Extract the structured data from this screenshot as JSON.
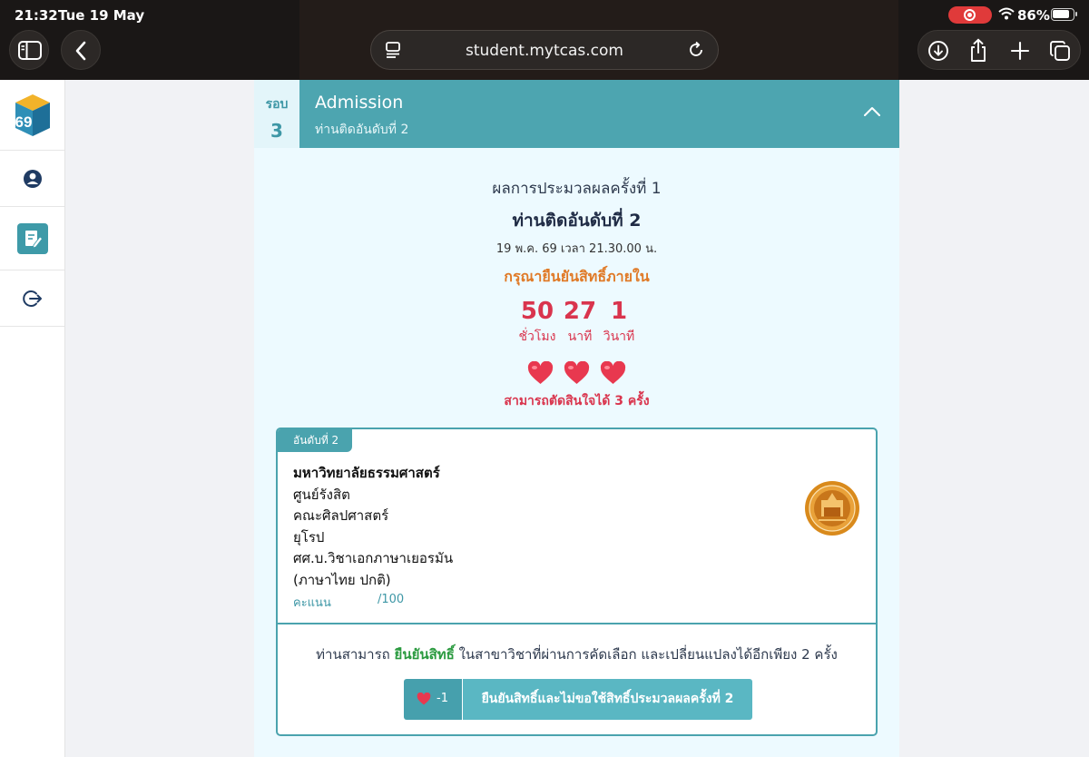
{
  "status_bar": {
    "time": "21:32",
    "date": "Tue 19 May",
    "battery": "86%"
  },
  "browser": {
    "url": "student.mytcas.com"
  },
  "sidebar": {
    "logo": "69",
    "items": [
      {
        "icon": "user-circle-icon"
      },
      {
        "icon": "edit-document-icon"
      },
      {
        "icon": "logout-icon"
      }
    ]
  },
  "round": {
    "label": "รอบ",
    "number": "3",
    "title": "Admission",
    "subtitle": "ท่านติดอันดับที่ 2"
  },
  "result": {
    "heading": "ผลการประมวลผลครั้งที่ 1",
    "rank": "ท่านติดอันดับที่ 2",
    "datetime": "19 พ.ค. 69 เวลา 21.30.00 น.",
    "confirm_prompt": "กรุณายืนยันสิทธิ์ภายใน",
    "countdown": {
      "hours": "50",
      "hours_label": "ชั่วโมง",
      "minutes": "27",
      "minutes_label": "นาที",
      "seconds": "1",
      "seconds_label": "วินาที"
    },
    "hearts_remaining": 3,
    "decisions_text": "สามารถตัดสินใจได้ 3 ครั้ง"
  },
  "program": {
    "rank_tag": "อันดับที่ 2",
    "university": "มหาวิทยาลัยธรรมศาสตร์",
    "campus": "ศูนย์รังสิต",
    "faculty": "คณะศิลปศาสตร์",
    "field": "ยุโรป",
    "major": "ศศ.บ.วิชาเอกภาษาเยอรมัน",
    "program_type": "(ภาษาไทย ปกติ)",
    "score_label": "คะแนน",
    "score_max": "/100"
  },
  "footer": {
    "text_before": "ท่านสามารถ ",
    "highlight": "ยืนยันสิทธิ์",
    "text_after": " ในสาขาวิชาที่ผ่านการคัดเลือก และเปลี่ยนแปลงได้อีกเพียง 2 ครั้ง",
    "button_cost": "-1",
    "button_label": "ยืนยันสิทธิ์และไม่ขอใช้สิทธิ์ประมวลผลครั้งที่ 2"
  },
  "colors": {
    "teal": "#4da5b0",
    "countdown_red": "#d9344d",
    "confirm_orange": "#e07a27",
    "highlight_green": "#2a9a3f"
  }
}
